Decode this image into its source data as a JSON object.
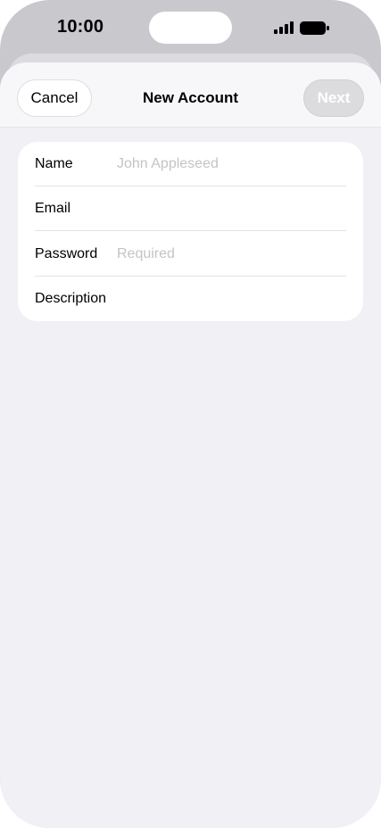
{
  "status_bar": {
    "time": "10:00",
    "signal_icon": "cellular-signal-icon",
    "battery_icon": "battery-icon"
  },
  "nav": {
    "cancel_label": "Cancel",
    "title": "New Account",
    "next_label": "Next"
  },
  "form": {
    "rows": [
      {
        "label": "Name",
        "placeholder": "John Appleseed",
        "value": ""
      },
      {
        "label": "Email",
        "placeholder": "",
        "value": ""
      },
      {
        "label": "Password",
        "placeholder": "Required",
        "value": ""
      },
      {
        "label": "Description",
        "placeholder": "",
        "value": ""
      }
    ]
  },
  "colors": {
    "background": "#F1F0F5",
    "card": "#FFFFFF",
    "next_disabled": "#DCDCDF",
    "placeholder": "#C4C4C8"
  }
}
